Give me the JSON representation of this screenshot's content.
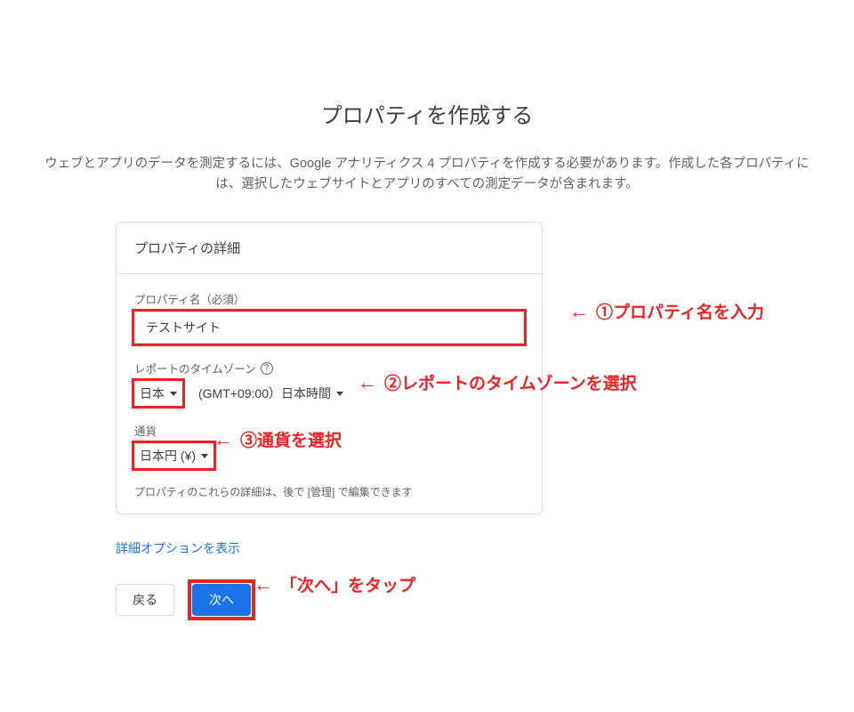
{
  "title": "プロパティを作成する",
  "intro_line1": "ウェブとアプリのデータを測定するには、Google アナリティクス 4 プロパティを作成する必要があります。作成した各プロパティには、選択したウェブサイトとアプリのすべての測定データが含まれます。",
  "card": {
    "header": "プロパティの詳細",
    "property_name_label": "プロパティ名（必須）",
    "property_name_value": "テストサイト",
    "timezone_label": "レポートのタイムゾーン",
    "timezone_country": "日本",
    "timezone_offset": "(GMT+09:00）日本時間",
    "currency_label": "通貨",
    "currency_value": "日本円 (¥)",
    "footer_note": "プロパティのこれらの詳細は、後で [管理] で編集できます"
  },
  "advanced_link": "詳細オプションを表示",
  "buttons": {
    "back": "戻る",
    "next": "次へ"
  },
  "callouts": {
    "arrow": "←",
    "c1": "①プロパティ名を入力",
    "c2": "②レポートのタイムゾーンを選択",
    "c3": "③通貨を選択",
    "c4": "「次へ」をタップ"
  }
}
